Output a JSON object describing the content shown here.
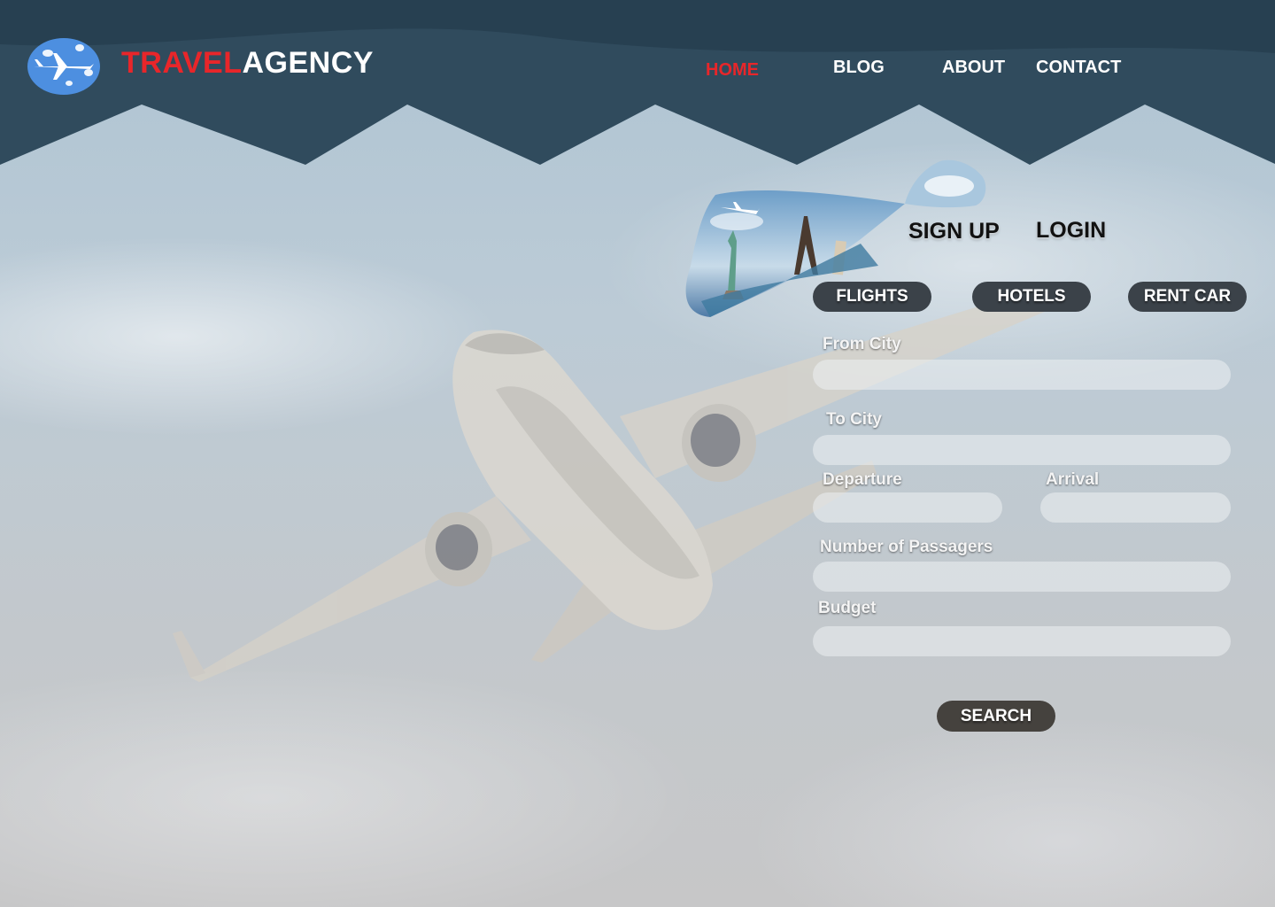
{
  "brand": {
    "name_part1": "TRAVEL",
    "name_part2": "AGENCY",
    "logo_icon": "airplane-logo-icon",
    "accent_color": "#e8262a"
  },
  "nav": {
    "items": [
      {
        "label": "HOME",
        "active": true
      },
      {
        "label": "BLOG",
        "active": false
      },
      {
        "label": "ABOUT",
        "active": false
      },
      {
        "label": "CONTACT",
        "active": false
      }
    ]
  },
  "auth": {
    "signup_label": "SIGN UP",
    "login_label": "LOGIN"
  },
  "tabs": [
    {
      "label": "FLIGHTS"
    },
    {
      "label": "HOTELS"
    },
    {
      "label": "RENT CAR"
    }
  ],
  "form": {
    "from_city_label": "From City",
    "to_city_label": "To City",
    "departure_label": "Departure",
    "arrival_label": "Arrival",
    "passengers_label": "Number of Passagers",
    "budget_label": "Budget",
    "from_city_value": "",
    "to_city_value": "",
    "departure_value": "",
    "arrival_value": "",
    "passengers_value": "",
    "budget_value": "",
    "search_label": "SEARCH"
  },
  "colors": {
    "header_band": "#294556",
    "tab_button": "#3b4249",
    "search_button": "#45423e"
  }
}
